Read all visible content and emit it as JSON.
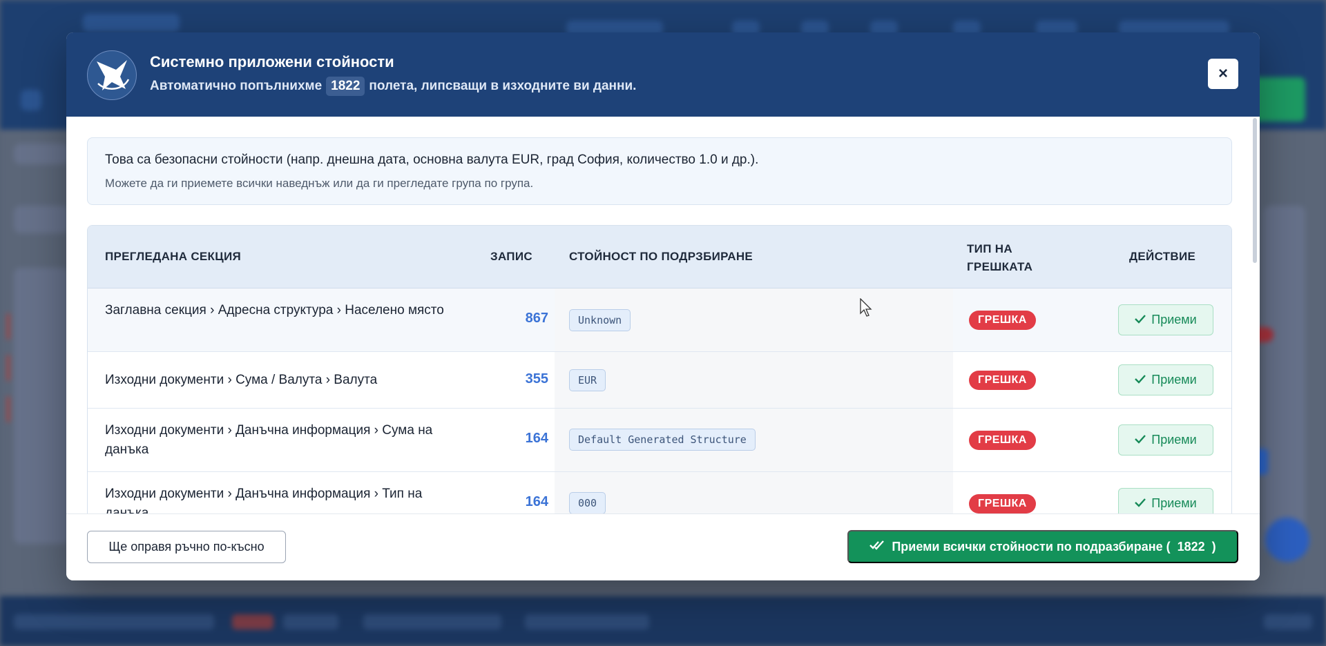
{
  "modal": {
    "title": "Системно приложени стойности",
    "subtitle_prefix": "Автоматично попълнихме",
    "subtitle_count": "1822",
    "subtitle_suffix": "полета, липсващи в изходните ви данни.",
    "close_label": "×"
  },
  "info": {
    "main": "Това са безопасни стойности (напр. днешна дата, основна валута EUR, град София, количество 1.0 и др.).",
    "sub": "Можете да ги приемете всички наведнъж или да ги прегледате група по група."
  },
  "table": {
    "headers": {
      "section": "ПРЕГЛЕДАНА СЕКЦИЯ",
      "record": "ЗАПИС",
      "default_value": "СТОЙНОСТ ПО ПОДРЗБИРАНЕ",
      "error_type_line1": "ТИП НА",
      "error_type_line2": "ГРЕШКАТА",
      "action": "ДЕЙСТВИЕ"
    },
    "rows": [
      {
        "section": "Заглавна секция › Адресна структура › Населено място",
        "record": "867",
        "default": "Unknown",
        "error": "ГРЕШКА",
        "action": "Приеми"
      },
      {
        "section": "Изходни документи › Сума / Валута › Валута",
        "record": "355",
        "default": "EUR",
        "error": "ГРЕШКА",
        "action": "Приеми"
      },
      {
        "section": "Изходни документи › Данъчна информация › Сума на данъка",
        "record": "164",
        "default": "Default Generated Structure",
        "error": "ГРЕШКА",
        "action": "Приеми"
      },
      {
        "section": "Изходни документи › Данъчна информация › Тип на данъка",
        "record": "164",
        "default": "000",
        "error": "ГРЕШКА",
        "action": "Приеми"
      }
    ]
  },
  "footer": {
    "later_label": "Ще оправя ръчно по-късно",
    "accept_all_label": "Приеми всички стойности по подразбиране (",
    "accept_all_count": "1822",
    "accept_all_close": ")"
  },
  "icons": {
    "logo": "star-swirl-logo",
    "accept": "check-icon",
    "accept_all": "double-check-icon",
    "close": "close-icon"
  },
  "colors": {
    "header_bg": "#1e4278",
    "error_badge": "#e23c46",
    "accept_green": "#13925a",
    "record_blue": "#3b73d6"
  }
}
